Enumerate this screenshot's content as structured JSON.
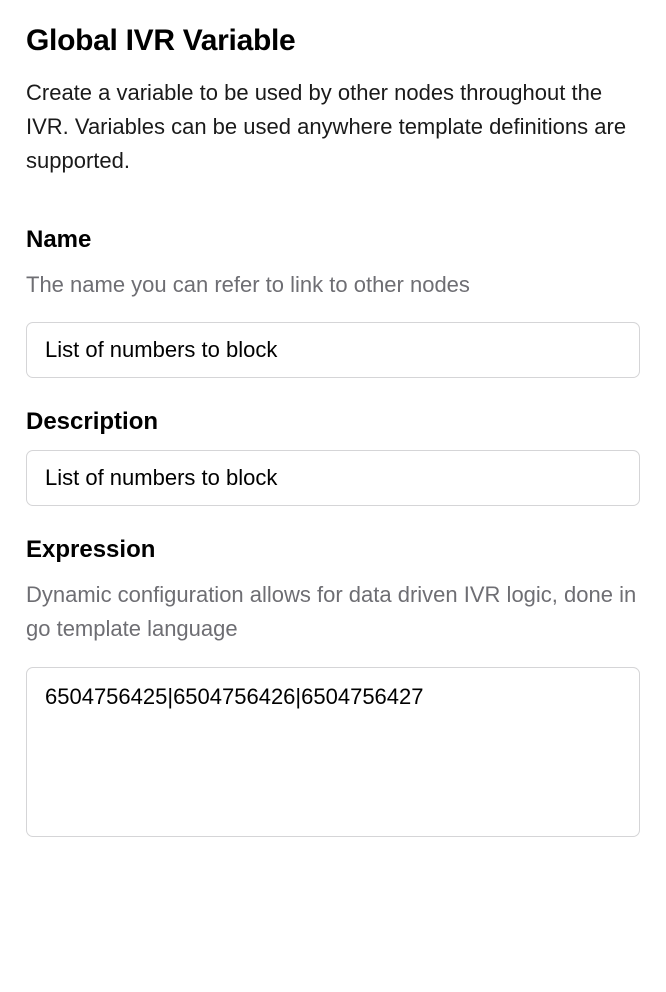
{
  "header": {
    "title": "Global IVR Variable",
    "subtitle": "Create a variable to be used by other nodes throughout the IVR. Variables can be used anywhere template definitions are supported."
  },
  "fields": {
    "name": {
      "label": "Name",
      "hint": "The name you can refer to link to other nodes",
      "value": "List of numbers to block"
    },
    "description": {
      "label": "Description",
      "value": "List of numbers to block"
    },
    "expression": {
      "label": "Expression",
      "hint": "Dynamic configuration allows for data driven IVR logic, done in go template language",
      "value": "6504756425|6504756426|6504756427"
    }
  }
}
